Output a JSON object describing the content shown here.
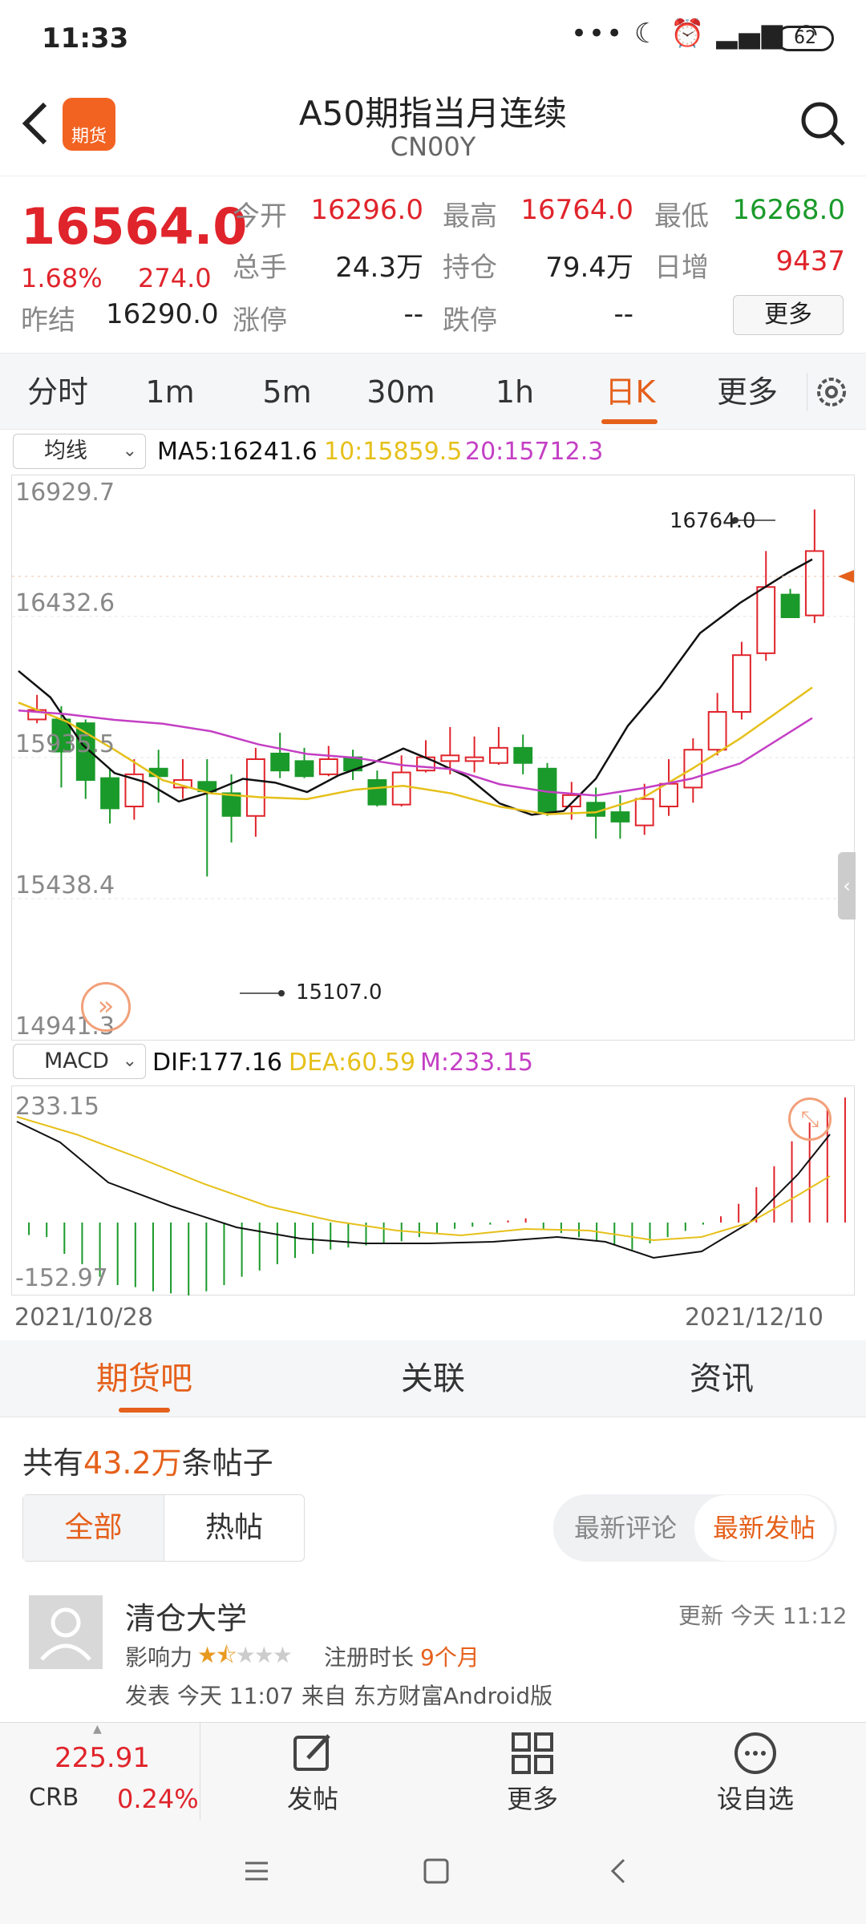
{
  "status_bar": {
    "time": "11:33",
    "battery": "62"
  },
  "header": {
    "logo_label": "期货",
    "title": "A50期指当月连续",
    "code": "CN00Y"
  },
  "quote": {
    "price": "16564.0",
    "change_pct": "1.68%",
    "change": "274.0",
    "prev_settle_label": "昨结",
    "prev_settle": "16290.0",
    "open_label": "今开",
    "open": "16296.0",
    "high_label": "最高",
    "high": "16764.0",
    "low_label": "最低",
    "low": "16268.0",
    "volume_label": "总手",
    "volume": "24.3万",
    "oi_label": "持仓",
    "oi": "79.4万",
    "daily_inc_label": "日增",
    "daily_inc": "9437",
    "limit_up_label": "涨停",
    "limit_up": "--",
    "limit_down_label": "跌停",
    "limit_down": "--",
    "more_label": "更多"
  },
  "period_tabs": [
    "分时",
    "1m",
    "5m",
    "30m",
    "1h",
    "日K",
    "更多"
  ],
  "active_period": "日K",
  "main_chart": {
    "indicator_select": "均线",
    "ma5": "MA5:16241.6",
    "ma10": "10:15859.5",
    "ma20": "20:15712.3",
    "y_labels": [
      "16929.7",
      "16432.6",
      "15935.5",
      "15438.4",
      "14941.3"
    ],
    "max_label": "16764.0",
    "min_label": "15107.0"
  },
  "macd_chart": {
    "indicator_select": "MACD",
    "dif": "DIF:177.16",
    "dea": "DEA:60.59",
    "m": "M:233.15",
    "y_top": "233.15",
    "y_bottom": "-152.97"
  },
  "date_range": {
    "start": "2021/10/28",
    "end": "2021/12/10"
  },
  "colors": {
    "up": "#e0242b",
    "down": "#1a9a2a",
    "accent": "#e5601b",
    "ma5": "#111111",
    "ma10": "#e6c01a",
    "ma20": "#c43fc4"
  },
  "community_tabs": [
    "期货吧",
    "关联",
    "资讯"
  ],
  "post_count": {
    "prefix": "共有",
    "count": "43.2万",
    "suffix": "条帖子"
  },
  "filter": {
    "all": "全部",
    "hot": "热帖",
    "latest_comment": "最新评论",
    "latest_post": "最新发帖"
  },
  "post": {
    "author": "清仓大学",
    "updated": "更新 今天 11:12",
    "influence_label": "影响力",
    "reg_label": "注册时长",
    "reg_value": "9个月",
    "published": "发表 今天 11:07",
    "source": "来自 东方财富Android版"
  },
  "bottom_bar": {
    "crb_value": "225.91",
    "crb_label": "CRB",
    "crb_pct": "0.24%",
    "post_label": "发帖",
    "more_label": "更多",
    "watch_label": "设自选"
  }
}
